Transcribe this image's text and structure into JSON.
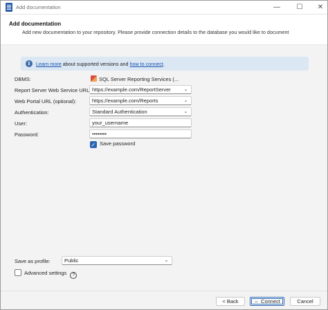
{
  "window": {
    "title": "Add documentation"
  },
  "header": {
    "title": "Add documentation",
    "description": "Add new documentation to your repository. Please provide connection details to the database you would like to document"
  },
  "info": {
    "link1": "Learn more",
    "text_mid": " about supported versions and ",
    "link2": "how to connect",
    "text_end": "."
  },
  "form": {
    "dbms_label": "DBMS:",
    "dbms_value": "SQL Server Reporting Services (...",
    "report_server_label": "Report Server Web Service URL:",
    "report_server_value": "https://example.com/ReportServer",
    "web_portal_label": "Web Portal URL (optional):",
    "web_portal_value": "https://example.com/Reports",
    "auth_label": "Authentication:",
    "auth_value": "Standard Authentication",
    "user_label": "User:",
    "user_value": "your_username",
    "password_label": "Password:",
    "password_value": "••••••••",
    "save_password_label": "Save password",
    "save_password_checked": true
  },
  "profile": {
    "label": "Save as profile:",
    "value": "Public"
  },
  "advanced": {
    "label": "Advanced settings",
    "checked": false
  },
  "footer": {
    "back_label": "< Back",
    "connect_label": "Connect",
    "cancel_label": "Cancel"
  },
  "icons": {
    "app": "document-icon",
    "minimize": "minimize-icon",
    "maximize": "maximize-icon",
    "close": "close-icon",
    "info": "info-icon",
    "dbms": "ssrs-icon",
    "dropdown": "chevron-down-icon",
    "help": "help-icon",
    "connect": "connect-icon"
  },
  "colors": {
    "accent": "#2b64b2",
    "info_bg": "#dbe7f3",
    "link": "#1a55b0"
  }
}
